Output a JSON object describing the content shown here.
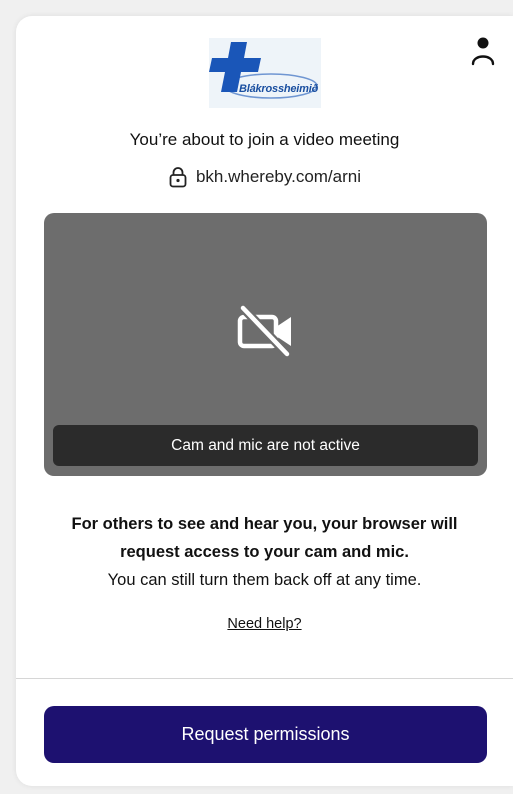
{
  "logo": {
    "text": "Blákrossheimið",
    "cross_color": "#1a56b8"
  },
  "header": {
    "user_icon": "user-icon"
  },
  "meeting": {
    "title": "You’re about to join a video meeting",
    "url": "bkh.whereby.com/arni",
    "lock_icon": "lock-icon"
  },
  "preview": {
    "icon": "camera-off-icon",
    "status": "Cam and mic are not active",
    "background": "#6d6d6d"
  },
  "info": {
    "line1": "For others to see and hear you, your browser will",
    "line2": "request access to your cam and mic.",
    "line3": "You can still turn them back off at any time."
  },
  "help": {
    "label": "Need help?"
  },
  "actions": {
    "request_label": "Request permissions",
    "button_color": "#1d1170"
  }
}
